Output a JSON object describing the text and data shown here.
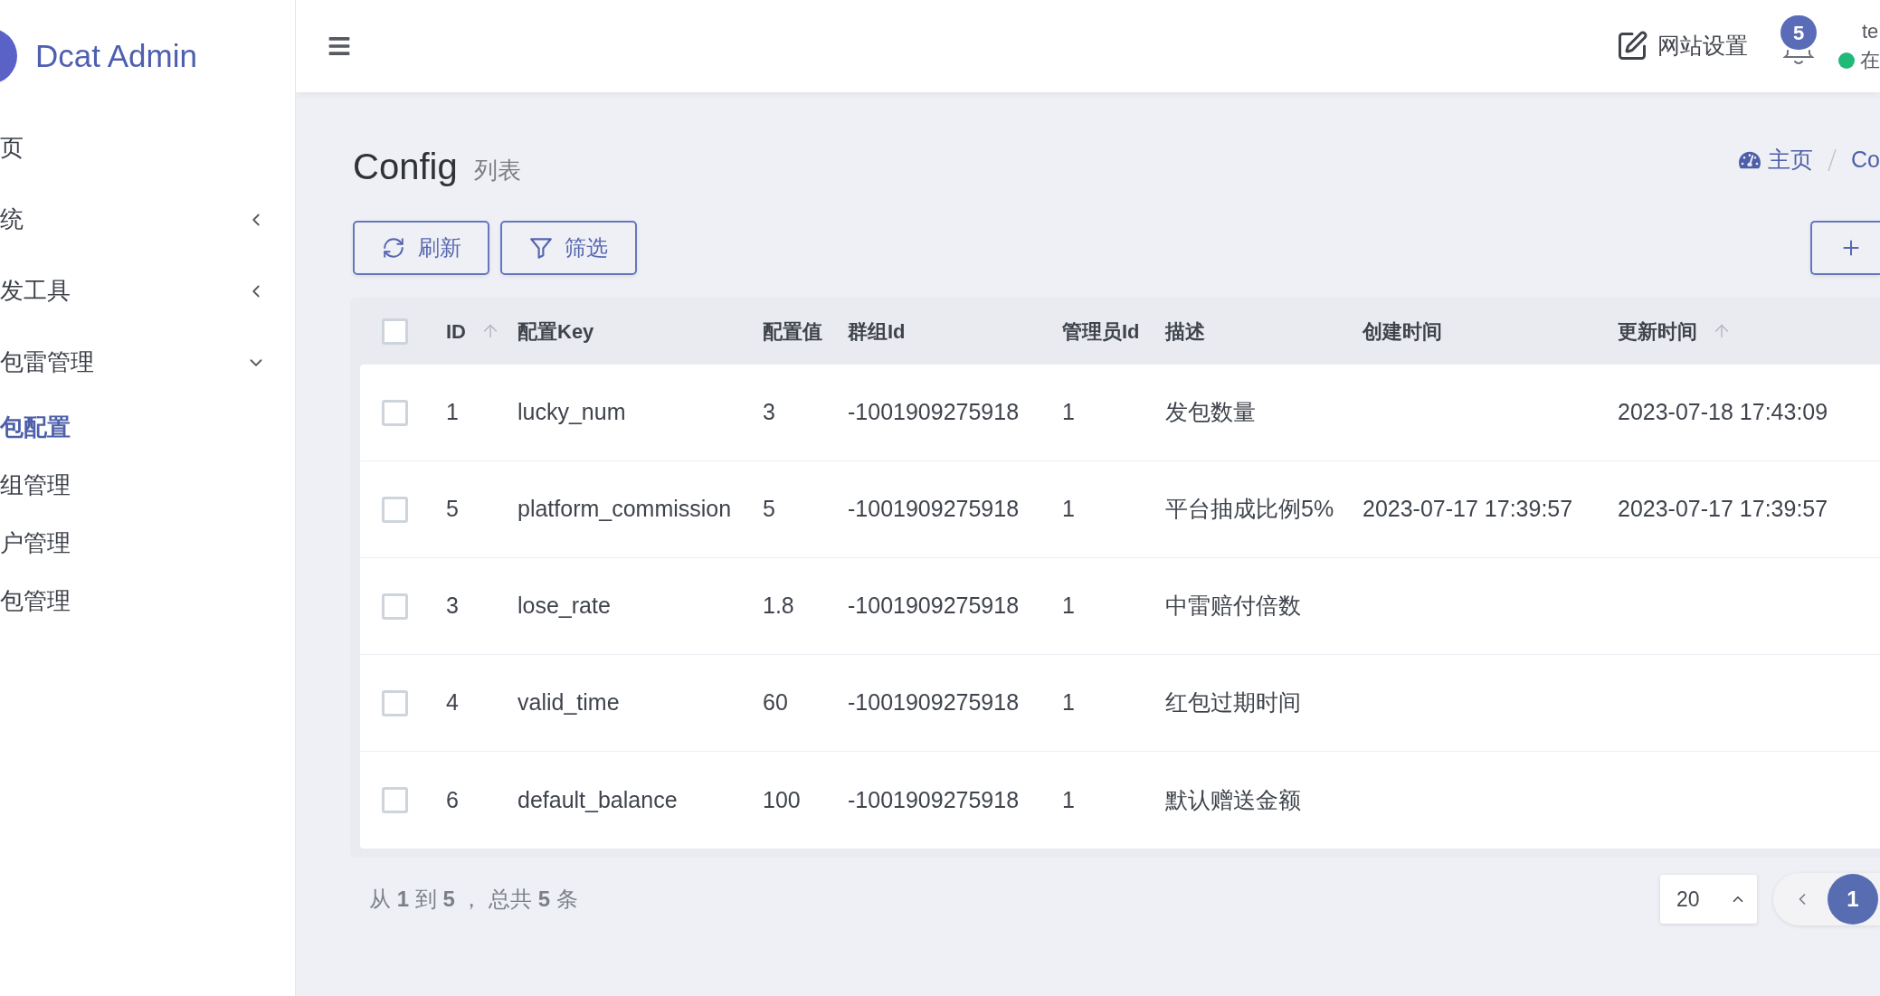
{
  "sidebar": {
    "logo": "Dcat Admin",
    "items": [
      {
        "label": "页",
        "kind": "link",
        "selected": false
      },
      {
        "label": "统",
        "kind": "group",
        "selected": false,
        "expanded": false
      },
      {
        "label": "发工具",
        "kind": "group",
        "selected": false,
        "expanded": false
      },
      {
        "label": "包雷管理",
        "kind": "group",
        "selected": false,
        "expanded": true,
        "children": [
          {
            "label": "包配置",
            "selected": true
          },
          {
            "label": "组管理",
            "selected": false
          },
          {
            "label": "户管理",
            "selected": false
          },
          {
            "label": "包管理",
            "selected": false
          }
        ]
      }
    ]
  },
  "header": {
    "settings_link": "网站设置",
    "notification_count": "5",
    "user": {
      "name": "te",
      "status": "在",
      "online": true
    }
  },
  "page": {
    "title": "Config",
    "subtitle": "列表",
    "breadcrumb": [
      "主页",
      "Co"
    ]
  },
  "toolbar": {
    "buttons": [
      {
        "kind": "refresh",
        "label": "刷新"
      },
      {
        "kind": "filter",
        "label": "筛选"
      }
    ]
  },
  "table": {
    "select_all": {
      "checked": false
    },
    "columns": [
      {
        "label": "ID",
        "sortable": true
      },
      {
        "label": "配置Key",
        "sortable": false
      },
      {
        "label": "配置值",
        "sortable": false
      },
      {
        "label": "群组Id",
        "sortable": false
      },
      {
        "label": "管理员Id",
        "sortable": false
      },
      {
        "label": "描述",
        "sortable": false
      },
      {
        "label": "创建时间",
        "sortable": false
      },
      {
        "label": "更新时间",
        "sortable": true
      }
    ],
    "rows": [
      {
        "checked": false,
        "id": "1",
        "key": "lucky_num",
        "value": "3",
        "group_id": "-1001909275918",
        "admin_id": "1",
        "description": "发包数量",
        "updated_at": "2023-07-18 17:43:09"
      },
      {
        "checked": false,
        "id": "5",
        "key": "platform_commission",
        "value": "5",
        "group_id": "-1001909275918",
        "admin_id": "1",
        "description": "平台抽成比例5%",
        "created_at": "2023-07-17 17:39:57",
        "updated_at": "2023-07-17 17:39:57"
      },
      {
        "checked": false,
        "id": "3",
        "key": "lose_rate",
        "value": "1.8",
        "group_id": "-1001909275918",
        "admin_id": "1",
        "description": "中雷赔付倍数"
      },
      {
        "checked": false,
        "id": "4",
        "key": "valid_time",
        "value": "60",
        "group_id": "-1001909275918",
        "admin_id": "1",
        "description": "红包过期时间"
      },
      {
        "checked": false,
        "id": "6",
        "key": "default_balance",
        "value": "100",
        "group_id": "-1001909275918",
        "admin_id": "1",
        "description": "默认赠送金额"
      }
    ]
  },
  "pagination": {
    "summary": "从 **1** 到 **5** ， 总共 **5** 条",
    "per_page": "20",
    "pages": [
      {
        "label": "1",
        "selected": true
      }
    ]
  }
}
